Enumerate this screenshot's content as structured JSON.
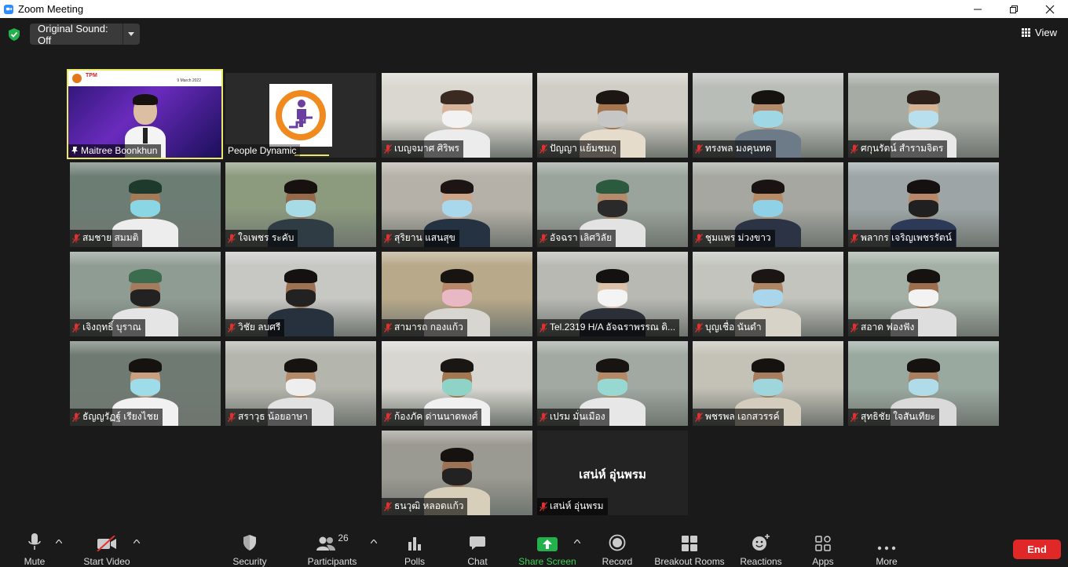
{
  "window": {
    "title": "Zoom Meeting"
  },
  "top": {
    "original_sound": "Original Sound: Off",
    "view_label": "View"
  },
  "tiles": [
    {
      "name": "Maitree Boonkhun",
      "muted": false,
      "active": true,
      "kind": "slide"
    },
    {
      "name": "People Dynamic",
      "muted": false,
      "kind": "logo"
    },
    {
      "name": "เบญจมาศ  ศิริพร",
      "muted": true,
      "kind": "video",
      "bg": "#d9d7cf",
      "skin": "#d8b49a",
      "hair": "#3b2a22",
      "mask": "#f2f2f2",
      "shirt": "#ececec"
    },
    {
      "name": "ปัญญา  แย้มชมภู",
      "muted": true,
      "kind": "video",
      "bg": "#cfcdc5",
      "skin": "#a7764f",
      "hair": "#1d1714",
      "mask": "#c6c6c6",
      "shirt": "#e6dccb"
    },
    {
      "name": "ทรงพล  มงคุนทด",
      "muted": true,
      "kind": "video",
      "bg": "#b9bdb8",
      "skin": "#b38a6a",
      "hair": "#151210",
      "mask": "#9fd8e4",
      "shirt": "#6d7b88"
    },
    {
      "name": "ศกุนรัตน์  สำรามจิตร",
      "muted": true,
      "kind": "video",
      "bg": "#a6aba4",
      "skin": "#d7b396",
      "hair": "#2e211c",
      "mask": "#b8dfee",
      "shirt": "#e9e9e9"
    },
    {
      "name": "สมชาย  สมมติ",
      "muted": true,
      "kind": "video",
      "bg": "#6c7d74",
      "skin": "#a57a57",
      "hair": "#1e3a2c",
      "mask": "#8bd6e4",
      "shirt": "#ededed"
    },
    {
      "name": "ใจเพชร  ระคับ",
      "muted": true,
      "kind": "video",
      "bg": "#8c9a7e",
      "skin": "#95694a",
      "hair": "#171210",
      "mask": "#a7dbe6",
      "shirt": "#2f3c44"
    },
    {
      "name": "สุริยาน  แสนสุข",
      "muted": true,
      "kind": "video",
      "bg": "#b6b1a8",
      "skin": "#cda588",
      "hair": "#1c1513",
      "mask": "#a9d8ec",
      "shirt": "#253242"
    },
    {
      "name": "อัจฉรา  เลิศวิลัย",
      "muted": true,
      "kind": "video",
      "bg": "#9aa39c",
      "skin": "#b58b6c",
      "hair": "#2c5a3e",
      "mask": "#2a2a2a",
      "shirt": "#e3e3e3"
    },
    {
      "name": "ชุมแพร  ม่วงขาว",
      "muted": true,
      "kind": "video",
      "bg": "#a5a7a0",
      "skin": "#b98a66",
      "hair": "#191411",
      "mask": "#8fd1e6",
      "shirt": "#2c3345"
    },
    {
      "name": "พลากร  เจริญเพชรรัตน์",
      "muted": true,
      "kind": "video",
      "bg": "#9da5a6",
      "skin": "#b7896a",
      "hair": "#141110",
      "mask": "#202020",
      "shirt": "#2d3a57"
    },
    {
      "name": "เจิงฤทธิ์  บุราณ",
      "muted": true,
      "kind": "video",
      "bg": "#8f9c93",
      "skin": "#a47c5d",
      "hair": "#3b6c4e",
      "mask": "#222222",
      "shirt": "#e5e5e5"
    },
    {
      "name": "วิชัย  ลบศรี",
      "muted": true,
      "kind": "video",
      "bg": "#c7c7c3",
      "skin": "#9d7253",
      "hair": "#141110",
      "mask": "#222222",
      "shirt": "#27303d"
    },
    {
      "name": "สามารถ  กองแก้ว",
      "muted": true,
      "kind": "video",
      "bg": "#b8a98a",
      "skin": "#b7896a",
      "hair": "#181412",
      "mask": "#e8b9c4",
      "shirt": "#d8d6d0"
    },
    {
      "name": "Tel.2319 H/A อัจฉราพรรณ ดิ...",
      "muted": true,
      "kind": "video",
      "bg": "#b9b9b4",
      "skin": "#dcc2aa",
      "hair": "#141110",
      "mask": "#f4f4f4",
      "shirt": "#2a2f38"
    },
    {
      "name": "บุญเชื่อ  นันดำ",
      "muted": true,
      "kind": "video",
      "bg": "#c2c4bd",
      "skin": "#b08564",
      "hair": "#1b1613",
      "mask": "#a9d6ea",
      "shirt": "#d7d3c8"
    },
    {
      "name": "สอาด  ฟองฟัง",
      "muted": true,
      "kind": "video",
      "bg": "#a4b0a6",
      "skin": "#9c6e4d",
      "hair": "#151210",
      "mask": "#f2f2f2",
      "shirt": "#dedede"
    },
    {
      "name": "ธัญญรัฏฐ์  เรียงไชย",
      "muted": true,
      "kind": "video",
      "bg": "#6f7a72",
      "skin": "#c99f80",
      "hair": "#151210",
      "mask": "#9fdcea",
      "shirt": "#f1f1f1"
    },
    {
      "name": "สราวุธ  น้อยอาษา",
      "muted": true,
      "kind": "video",
      "bg": "#b4b5ad",
      "skin": "#b48a69",
      "hair": "#171311",
      "mask": "#eeeeee",
      "shirt": "#e2e2e2"
    },
    {
      "name": "ก้องภัค  ด่านนาดพงศ์",
      "muted": true,
      "kind": "video",
      "bg": "#d8d6d1",
      "skin": "#a3774f",
      "hair": "#1a1613",
      "mask": "#8fd2c6",
      "shirt": "#f0f0f0"
    },
    {
      "name": "เปรม  มั่นเมือง",
      "muted": true,
      "kind": "video",
      "bg": "#a1a9a2",
      "skin": "#b58966",
      "hair": "#181412",
      "mask": "#98d8d2",
      "shirt": "#e7e7e7"
    },
    {
      "name": "พชรพล  เอกสวรรค์",
      "muted": true,
      "kind": "video",
      "bg": "#c4c1b7",
      "skin": "#a87e5e",
      "hair": "#151210",
      "mask": "#9fd6de",
      "shirt": "#d4cdbd"
    },
    {
      "name": "สุทธิชัย  ใจสันเทียะ",
      "muted": true,
      "kind": "video",
      "bg": "#9aa9a0",
      "skin": "#a97f60",
      "hair": "#151210",
      "mask": "#b0dbe8",
      "shirt": "#dadada"
    },
    {
      "name": "ธนวุฒิ  หลอดแก้ว",
      "muted": true,
      "kind": "video",
      "bg": "#9b9a92",
      "skin": "#9e7355",
      "hair": "#151210",
      "mask": "#222222",
      "shirt": "#d7cfb9"
    },
    {
      "name": "เสน่ห์ อุ่นพรม",
      "muted": true,
      "kind": "text",
      "big": "เสน่ห์ อุ่นพรม"
    }
  ],
  "slide": {
    "header": "TPM",
    "date": "9 March 2022"
  },
  "toolbar": {
    "mute": "Mute",
    "start_video": "Start Video",
    "security": "Security",
    "participants": "Participants",
    "participants_count": "26",
    "polls": "Polls",
    "chat": "Chat",
    "share_screen": "Share Screen",
    "record": "Record",
    "breakout_rooms": "Breakout Rooms",
    "reactions": "Reactions",
    "apps": "Apps",
    "more": "More",
    "end": "End"
  },
  "colors": {
    "active_outline": "#e9e966",
    "share_green": "#3fcf58",
    "end_red": "#e02828",
    "accent": "#2d8cff"
  }
}
